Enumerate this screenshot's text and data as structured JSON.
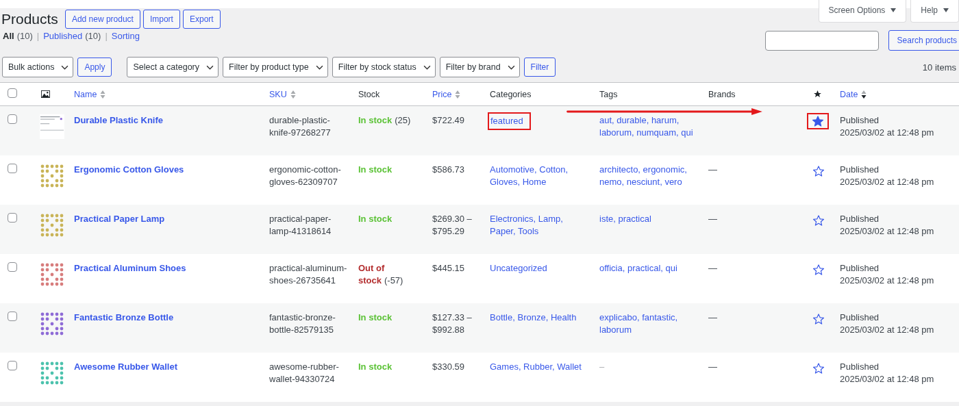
{
  "page_title": "Products",
  "header_buttons": [
    "Add new product",
    "Import",
    "Export"
  ],
  "screen_tabs": [
    "Screen Options",
    "Help"
  ],
  "views": [
    {
      "label": "All",
      "count": "(10)",
      "selected": true
    },
    {
      "label": "Published",
      "count": "(10)",
      "selected": false
    },
    {
      "label": "Sorting",
      "selected": false
    }
  ],
  "view_separator": "|",
  "search": {
    "button": "Search products"
  },
  "bulk_select": "Bulk actions",
  "apply_button": "Apply",
  "filters": [
    "Select a category",
    "Filter by product type",
    "Filter by stock status",
    "Filter by brand"
  ],
  "filter_button": "Filter",
  "items_count": "10 items",
  "columns": [
    {
      "kind": "checkbox",
      "checked": false
    },
    {
      "kind": "image"
    },
    {
      "kind": "text",
      "label": "Name",
      "sortable": true,
      "sorted": false
    },
    {
      "kind": "text",
      "label": "SKU",
      "sortable": true,
      "sorted": false
    },
    {
      "kind": "text",
      "label": "Stock",
      "sortable": false,
      "sorted": false
    },
    {
      "kind": "text",
      "label": "Price",
      "sortable": true,
      "sorted": false
    },
    {
      "kind": "text",
      "label": "Categories",
      "sortable": false,
      "sorted": false
    },
    {
      "kind": "text",
      "label": "Tags",
      "sortable": false,
      "sorted": false
    },
    {
      "kind": "text",
      "label": "Brands",
      "sortable": false,
      "sorted": false
    },
    {
      "kind": "star"
    },
    {
      "kind": "text",
      "label": "Date",
      "sortable": true,
      "sorted": true
    }
  ],
  "rows": [
    {
      "checked": false,
      "thumbnail": {
        "kind": "screenshot"
      },
      "name": "Durable Plastic Knife",
      "sku": "durable-plastic-knife-97268277",
      "stock": {
        "in_stock": true,
        "label": "In stock",
        "count": "(25)"
      },
      "price": "$722.49",
      "categories": "featured",
      "tags": "aut, durable, harum, laborum, numquam, qui",
      "brands": "",
      "featured": true,
      "highlighted": true,
      "status": "Published",
      "date": "2025/03/02 at 12:48 pm"
    },
    {
      "checked": false,
      "thumbnail": {
        "kind": "pattern",
        "color": "#c9b458"
      },
      "name": "Ergonomic Cotton Gloves",
      "sku": "ergonomic-cotton-gloves-62309707",
      "stock": {
        "in_stock": true,
        "label": "In stock"
      },
      "price": "$586.73",
      "categories": "Automotive, Cotton, Gloves, Home",
      "tags": "architecto, ergonomic, nemo, nesciunt, vero",
      "brands": "—",
      "featured": false,
      "highlighted": false,
      "status": "Published",
      "date": "2025/03/02 at 12:48 pm"
    },
    {
      "checked": false,
      "thumbnail": {
        "kind": "pattern",
        "color": "#c9b458"
      },
      "name": "Practical Paper Lamp",
      "sku": "practical-paper-lamp-41318614",
      "stock": {
        "in_stock": true,
        "label": "In stock"
      },
      "price": "$269.30 – $795.29",
      "categories": "Electronics, Lamp, Paper, Tools",
      "tags": "iste, practical",
      "brands": "—",
      "featured": false,
      "highlighted": false,
      "status": "Published",
      "date": "2025/03/02 at 12:48 pm"
    },
    {
      "checked": false,
      "thumbnail": {
        "kind": "pattern",
        "color": "#d77d7d"
      },
      "name": "Practical Aluminum Shoes",
      "sku": "practical-aluminum-shoes-26735641",
      "stock": {
        "in_stock": false,
        "label": "Out of stock",
        "count": "(-57)"
      },
      "price": "$445.15",
      "categories": "Uncategorized",
      "tags": "officia, practical, qui",
      "brands": "—",
      "featured": false,
      "highlighted": false,
      "status": "Published",
      "date": "2025/03/02 at 12:48 pm"
    },
    {
      "checked": false,
      "thumbnail": {
        "kind": "pattern",
        "color": "#8e6bd6"
      },
      "name": "Fantastic Bronze Bottle",
      "sku": "fantastic-bronze-bottle-82579135",
      "stock": {
        "in_stock": true,
        "label": "In stock"
      },
      "price": "$127.33 – $992.88",
      "categories": "Bottle, Bronze, Health",
      "tags": "explicabo, fantastic, laborum",
      "brands": "—",
      "featured": false,
      "highlighted": false,
      "status": "Published",
      "date": "2025/03/02 at 12:48 pm"
    },
    {
      "checked": false,
      "thumbnail": {
        "kind": "pattern",
        "color": "#4cc2ad"
      },
      "name": "Awesome Rubber Wallet",
      "sku": "awesome-rubber-wallet-94330724",
      "stock": {
        "in_stock": true,
        "label": "In stock"
      },
      "price": "$330.59",
      "categories": "Games, Rubber, Wallet",
      "tags": "–",
      "brands": "—",
      "featured": false,
      "highlighted": false,
      "status": "Published",
      "date": "2025/03/02 at 12:48 pm"
    }
  ]
}
